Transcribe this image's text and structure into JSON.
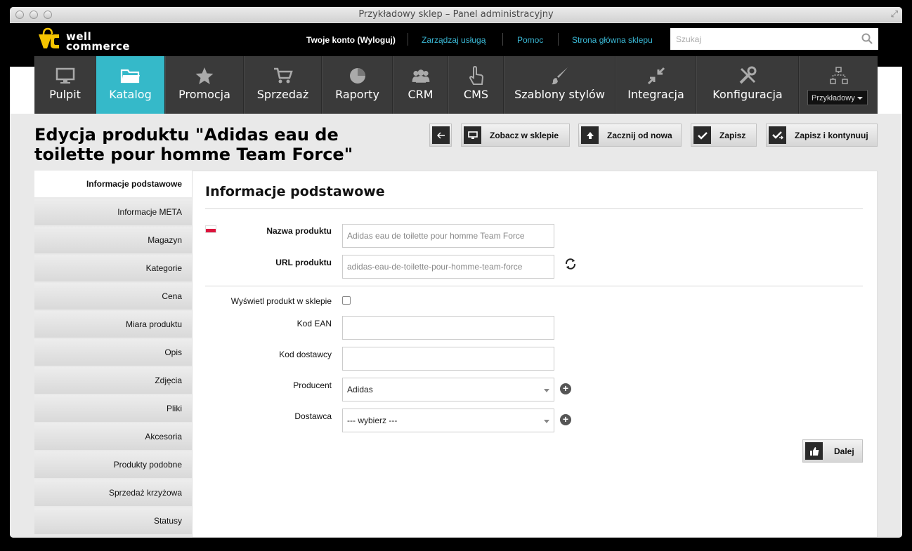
{
  "window": {
    "title": "Przykładowy sklep – Panel administracyjny"
  },
  "logo": {
    "line1": "well",
    "line2": "commerce"
  },
  "topbar": {
    "account": "Twoje konto",
    "logout": "(Wyloguj)",
    "manage": "Zarządzaj usługą",
    "help": "Pomoc",
    "store_home": "Strona główna sklepu",
    "search_placeholder": "Szukaj"
  },
  "nav": {
    "items": [
      {
        "label": "Pulpit",
        "icon": "monitor-icon"
      },
      {
        "label": "Katalog",
        "icon": "folder-icon"
      },
      {
        "label": "Promocja",
        "icon": "star-icon"
      },
      {
        "label": "Sprzedaż",
        "icon": "cart-icon"
      },
      {
        "label": "Raporty",
        "icon": "pie-chart-icon"
      },
      {
        "label": "CRM",
        "icon": "users-icon"
      },
      {
        "label": "CMS",
        "icon": "hand-pointer-icon"
      },
      {
        "label": "Szablony stylów",
        "icon": "brush-icon"
      },
      {
        "label": "Integracja",
        "icon": "arrows-in-icon"
      },
      {
        "label": "Konfiguracja",
        "icon": "tools-icon"
      }
    ],
    "active_index": 1,
    "store_select": "Przykładowy"
  },
  "page": {
    "title": "Edycja produktu \"Adidas eau de toilette pour homme Team Force\""
  },
  "toolbar": {
    "view": "Zobacz w sklepie",
    "restart": "Zacznij od nowa",
    "save": "Zapisz",
    "save_continue": "Zapisz i kontynuuj"
  },
  "sidebar": {
    "items": [
      "Informacje podstawowe",
      "Informacje META",
      "Magazyn",
      "Kategorie",
      "Cena",
      "Miara produktu",
      "Opis",
      "Zdjęcia",
      "Pliki",
      "Akcesoria",
      "Produkty podobne",
      "Sprzedaż krzyżowa",
      "Statusy"
    ],
    "active_index": 0
  },
  "form": {
    "title": "Informacje podstawowe",
    "name_label": "Nazwa produktu",
    "name_value": "Adidas eau de toilette pour homme Team Force",
    "url_label": "URL produktu",
    "url_value": "adidas-eau-de-toilette-pour-homme-team-force",
    "show_label": "Wyświetl produkt w sklepie",
    "show_checked": false,
    "ean_label": "Kod EAN",
    "ean_value": "",
    "supplier_code_label": "Kod dostawcy",
    "supplier_code_value": "",
    "producer_label": "Producent",
    "producer_value": "Adidas",
    "supplier_label": "Dostawca",
    "supplier_value": "--- wybierz ---",
    "next_button": "Dalej"
  },
  "colors": {
    "accent": "#35b9c9",
    "link": "#3ab8d5",
    "nav_bg": "#3a3a3a",
    "logo_yellow": "#f5c400"
  }
}
